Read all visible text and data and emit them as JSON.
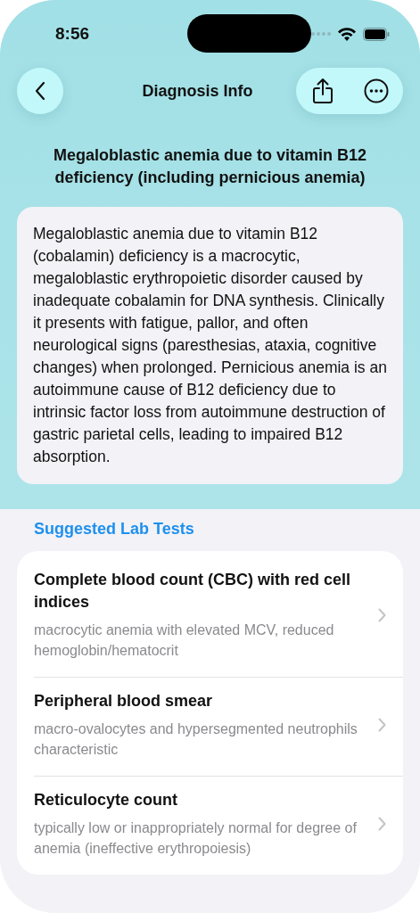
{
  "status_bar": {
    "time": "8:56"
  },
  "nav": {
    "title": "Diagnosis Info"
  },
  "diagnosis": {
    "title": "Megaloblastic anemia due to vitamin B12 deficiency (including pernicious anemia)",
    "description": "Megaloblastic anemia due to vitamin B12 (cobalamin) deficiency is a macrocytic, megaloblastic erythropoietic disorder caused by inadequate cobalamin for DNA synthesis. Clinically it presents with fatigue, pallor, and often neurological signs (paresthesias, ataxia, cognitive changes) when prolonged. Pernicious anemia is an autoimmune cause of B12 deficiency due to intrinsic factor loss from autoimmune destruction of gastric parietal cells, leading to impaired B12 absorption."
  },
  "lab_tests": {
    "heading": "Suggested Lab Tests",
    "items": [
      {
        "name": "Complete blood count (CBC) with red cell indices",
        "finding": "macrocytic anemia with elevated MCV, reduced hemoglobin/hematocrit"
      },
      {
        "name": "Peripheral blood smear",
        "finding": "macro-ovalocytes and hypersegmented neutrophils characteristic"
      },
      {
        "name": "Reticulocyte count",
        "finding": "typically low or inappropriately normal for degree of anemia (ineffective erythropoiesis)"
      }
    ]
  }
}
